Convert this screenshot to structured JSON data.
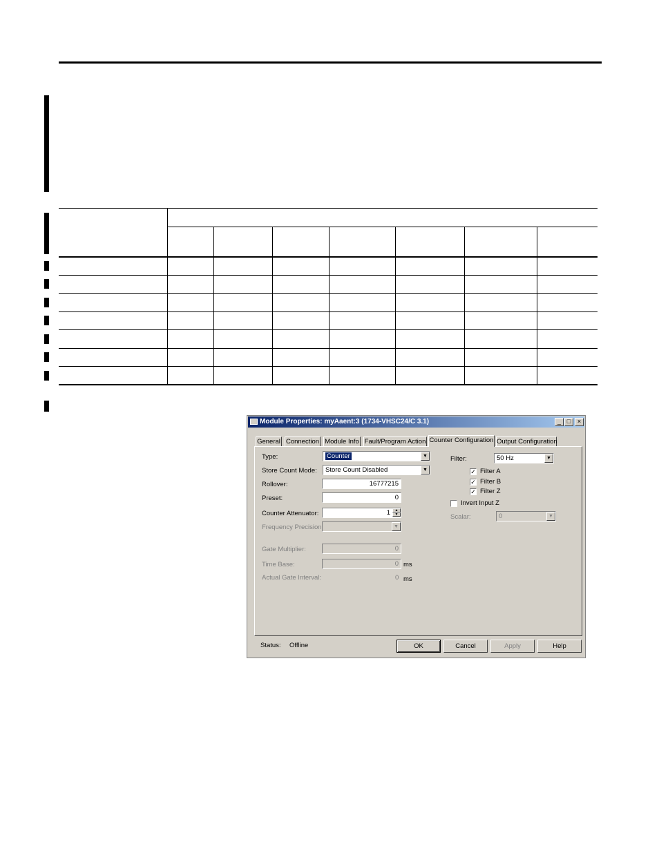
{
  "dialog": {
    "title": "Module Properties: myAaent:3 (1734-VHSC24/C 3.1)",
    "tabs": [
      {
        "label": "General"
      },
      {
        "label": "Connection"
      },
      {
        "label": "Module Info"
      },
      {
        "label": "Fault/Program Action"
      },
      {
        "label": "Counter Configuration",
        "active": true
      },
      {
        "label": "Output Configuration"
      }
    ],
    "fields": {
      "type_label": "Type:",
      "type_value": "Counter",
      "store_count_label": "Store Count Mode:",
      "store_count_value": "Store Count Disabled",
      "rollover_label": "Rollover:",
      "rollover_value": "16777215",
      "preset_label": "Preset:",
      "preset_value": "0",
      "attenuator_label": "Counter Attenuator:",
      "attenuator_value": "1",
      "freq_precision_label": "Frequency Precision:",
      "freq_precision_value": "",
      "gate_multiplier_label": "Gate Multiplier:",
      "gate_multiplier_value": "0",
      "time_base_label": "Time Base:",
      "time_base_value": "0",
      "time_base_unit": "ms",
      "actual_gate_label": "Actual Gate Interval:",
      "actual_gate_value": "0",
      "actual_gate_unit": "ms",
      "filter_label": "Filter:",
      "filter_value": "50 Hz",
      "filter_a_label": "Filter A",
      "filter_b_label": "Filter B",
      "filter_z_label": "Filter Z",
      "invert_z_label": "Invert Input Z",
      "scalar_label": "Scalar:",
      "scalar_value": "0"
    },
    "checkboxes": {
      "filter_a": true,
      "filter_b": true,
      "filter_z": true,
      "invert_z": false
    },
    "status_label": "Status:",
    "status_value": "Offline",
    "buttons": {
      "ok": "OK",
      "cancel": "Cancel",
      "apply": "Apply",
      "help": "Help"
    }
  },
  "colors": {
    "title_start": "#0a246a",
    "title_end": "#a6caf0",
    "face": "#d4d0c8"
  }
}
